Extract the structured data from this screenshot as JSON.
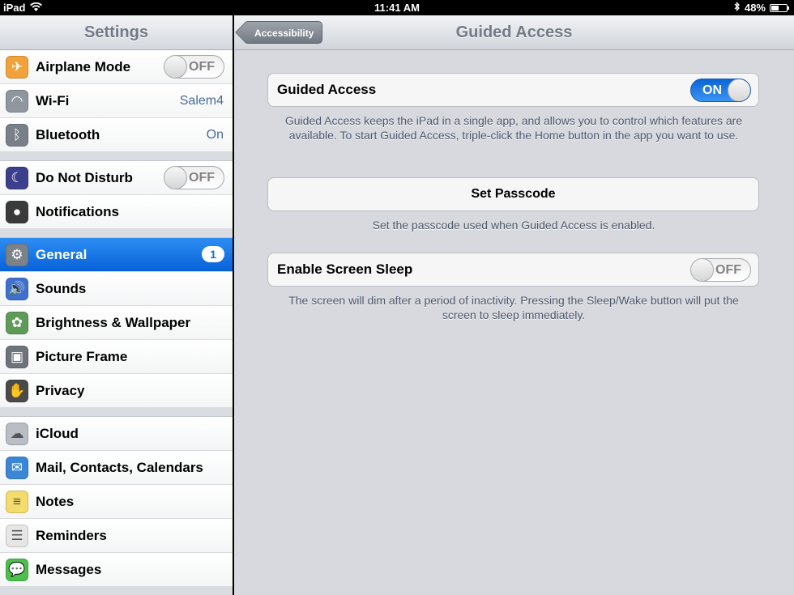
{
  "status_bar": {
    "device": "iPad",
    "time": "11:41 AM",
    "battery": "48%",
    "battery_level": 0.48
  },
  "master": {
    "title": "Settings",
    "groups": [
      [
        {
          "label": "Airplane Mode",
          "icon": "airplane-icon",
          "icon_color": "#f2a23a",
          "accessory": "switch",
          "switch_text": "OFF"
        },
        {
          "label": "Wi-Fi",
          "icon": "wifi-icon",
          "icon_color": "#8f969e",
          "value": "Salem4"
        },
        {
          "label": "Bluetooth",
          "icon": "bluetooth-icon",
          "icon_color": "#7a8088",
          "value": "On"
        }
      ],
      [
        {
          "label": "Do Not Disturb",
          "icon": "moon-icon",
          "icon_color": "#3b3f8c",
          "accessory": "switch",
          "switch_text": "OFF"
        },
        {
          "label": "Notifications",
          "icon": "notifications-icon",
          "icon_color": "#3a3a3a"
        }
      ],
      [
        {
          "label": "General",
          "icon": "gear-icon",
          "icon_color": "#7c828a",
          "badge": "1",
          "selected": true
        },
        {
          "label": "Sounds",
          "icon": "speaker-icon",
          "icon_color": "#3f6fcf"
        },
        {
          "label": "Brightness & Wallpaper",
          "icon": "flower-icon",
          "icon_color": "#5e9b58"
        },
        {
          "label": "Picture Frame",
          "icon": "picture-frame-icon",
          "icon_color": "#6d737a"
        },
        {
          "label": "Privacy",
          "icon": "hand-icon",
          "icon_color": "#4a4a4a"
        }
      ],
      [
        {
          "label": "iCloud",
          "icon": "cloud-icon",
          "icon_color": "#b9bec4"
        },
        {
          "label": "Mail, Contacts, Calendars",
          "icon": "mail-icon",
          "icon_color": "#3c86d8"
        },
        {
          "label": "Notes",
          "icon": "notes-icon",
          "icon_color": "#f3dc6c"
        },
        {
          "label": "Reminders",
          "icon": "reminders-icon",
          "icon_color": "#e6e6e6"
        },
        {
          "label": "Messages",
          "icon": "messages-icon",
          "icon_color": "#4cbf4c"
        }
      ]
    ]
  },
  "detail": {
    "title": "Guided Access",
    "back_label": "Accessibility",
    "guided_access": {
      "label": "Guided Access",
      "switch_text": "ON",
      "footer": "Guided Access keeps the iPad in a single app, and allows you to control which features are available. To start Guided Access, triple-click the Home button in the app you want to use."
    },
    "set_passcode": {
      "label": "Set Passcode",
      "footer": "Set the passcode used when Guided Access is enabled."
    },
    "screen_sleep": {
      "label": "Enable Screen Sleep",
      "switch_text": "OFF",
      "footer": "The screen will dim after a period of inactivity. Pressing the Sleep/Wake button will put the screen to sleep immediately."
    }
  }
}
